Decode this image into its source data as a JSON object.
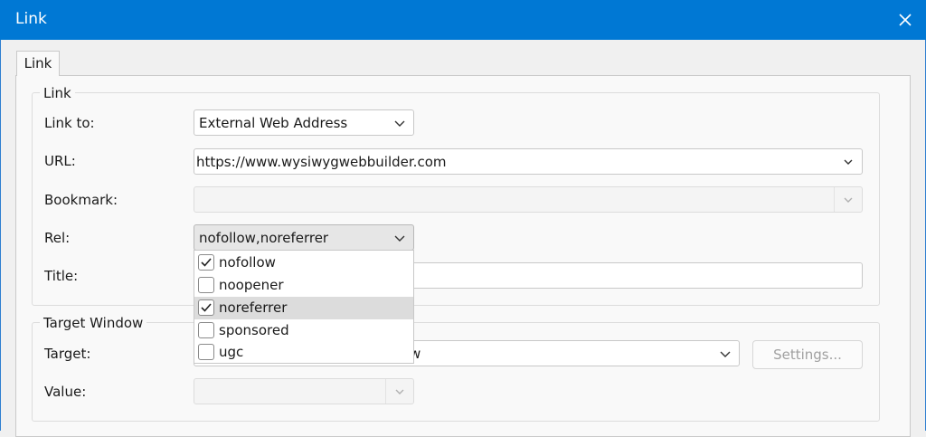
{
  "window": {
    "title": "Link"
  },
  "tab": {
    "label": "Link"
  },
  "link_group": {
    "legend": "Link",
    "link_to": {
      "label": "Link to:",
      "value": "External Web Address"
    },
    "url": {
      "label": "URL:",
      "value": "https://www.wysiwygwebbuilder.com"
    },
    "bookmark": {
      "label": "Bookmark:",
      "value": ""
    },
    "rel": {
      "label": "Rel:",
      "value": "nofollow,noreferrer",
      "options": [
        {
          "label": "nofollow",
          "checked": true
        },
        {
          "label": "noopener",
          "checked": false
        },
        {
          "label": "noreferrer",
          "checked": true
        },
        {
          "label": "sponsored",
          "checked": false
        },
        {
          "label": "ugc",
          "checked": false
        }
      ]
    },
    "title": {
      "label": "Title:",
      "value": ""
    }
  },
  "target_group": {
    "legend": "Target Window",
    "target": {
      "label": "Target:",
      "value_partial": "w"
    },
    "settings_button": "Settings...",
    "value": {
      "label": "Value:",
      "value": ""
    }
  }
}
